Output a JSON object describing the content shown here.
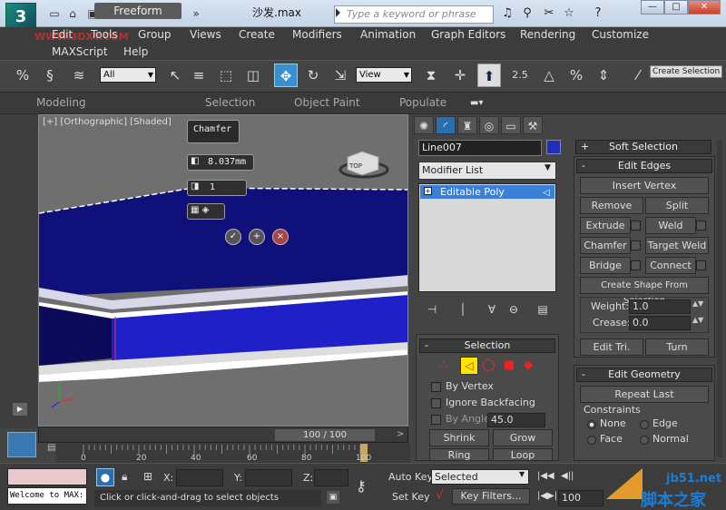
{
  "title_bar": {
    "file_name": "沙发.max",
    "search_placeholder": "Type a keyword or phrase",
    "logo_glyph": "3"
  },
  "watermark_top": "WWW.3DXY.COM",
  "menu": {
    "row1": [
      "Edit",
      "Tools",
      "Group",
      "Views",
      "Create",
      "Modifiers",
      "Animation",
      "Graph Editors",
      "Rendering",
      "Customize"
    ],
    "row2": [
      "MAXScript",
      "Help"
    ]
  },
  "toolbar": {
    "selection_filter": "All",
    "ref_coord": "View",
    "snap_label": "2.5",
    "create_selection": "Create Selection"
  },
  "ribbon": {
    "tabs": [
      "Modeling",
      "Freeform",
      "Selection",
      "Object Paint",
      "Populate"
    ]
  },
  "viewport": {
    "label": "[+] [Orthographic] [Shaded]",
    "caddy_title": "Chamfer",
    "chamfer_amount": "8.037mm",
    "chamfer_segments": "1",
    "viewcube_label": "TOP"
  },
  "command_panel": {
    "object_name": "Line007",
    "object_color": "#1f2fb8",
    "modifier_list": "Modifier List",
    "stack_item": "Editable Poly",
    "selection": {
      "header": "Selection",
      "by_vertex": "By Vertex",
      "ignore_backfacing": "Ignore Backfacing",
      "by_angle": "By Angle:",
      "angle_value": "45.0",
      "shrink": "Shrink",
      "grow": "Grow",
      "ring": "Ring",
      "loop": "Loop"
    },
    "soft_selection": "Soft Selection",
    "edit_edges": {
      "header": "Edit Edges",
      "insert_vertex": "Insert Vertex",
      "remove": "Remove",
      "split": "Split",
      "extrude": "Extrude",
      "weld": "Weld",
      "chamfer": "Chamfer",
      "target_weld": "Target Weld",
      "bridge": "Bridge",
      "connect": "Connect",
      "create_shape": "Create Shape From Selection",
      "weight_label": "Weight:",
      "weight_value": "1.0",
      "crease_label": "Crease:",
      "crease_value": "0.0",
      "edit_tri": "Edit Tri.",
      "turn": "Turn"
    },
    "edit_geometry": {
      "header": "Edit Geometry",
      "repeat_last": "Repeat Last",
      "constraints": "Constraints",
      "none": "None",
      "edge": "Edge",
      "face": "Face",
      "normal": "Normal"
    }
  },
  "timeline": {
    "slider": "100 / 100",
    "current_frame": 100,
    "ticks": [
      "0",
      "20",
      "40",
      "60",
      "80",
      "100"
    ]
  },
  "status": {
    "welcome": "Welcome to MAX:",
    "prompt": "Click or click-and-drag to select objects",
    "x_label": "X:",
    "y_label": "Y:",
    "z_label": "Z:",
    "auto_key": "Auto Key",
    "set_key": "Set Key",
    "selected": "Selected",
    "key_filters": "Key Filters...",
    "frame": "100"
  },
  "site_watermark": {
    "url": "jb51.net",
    "name": "脚本之家"
  }
}
